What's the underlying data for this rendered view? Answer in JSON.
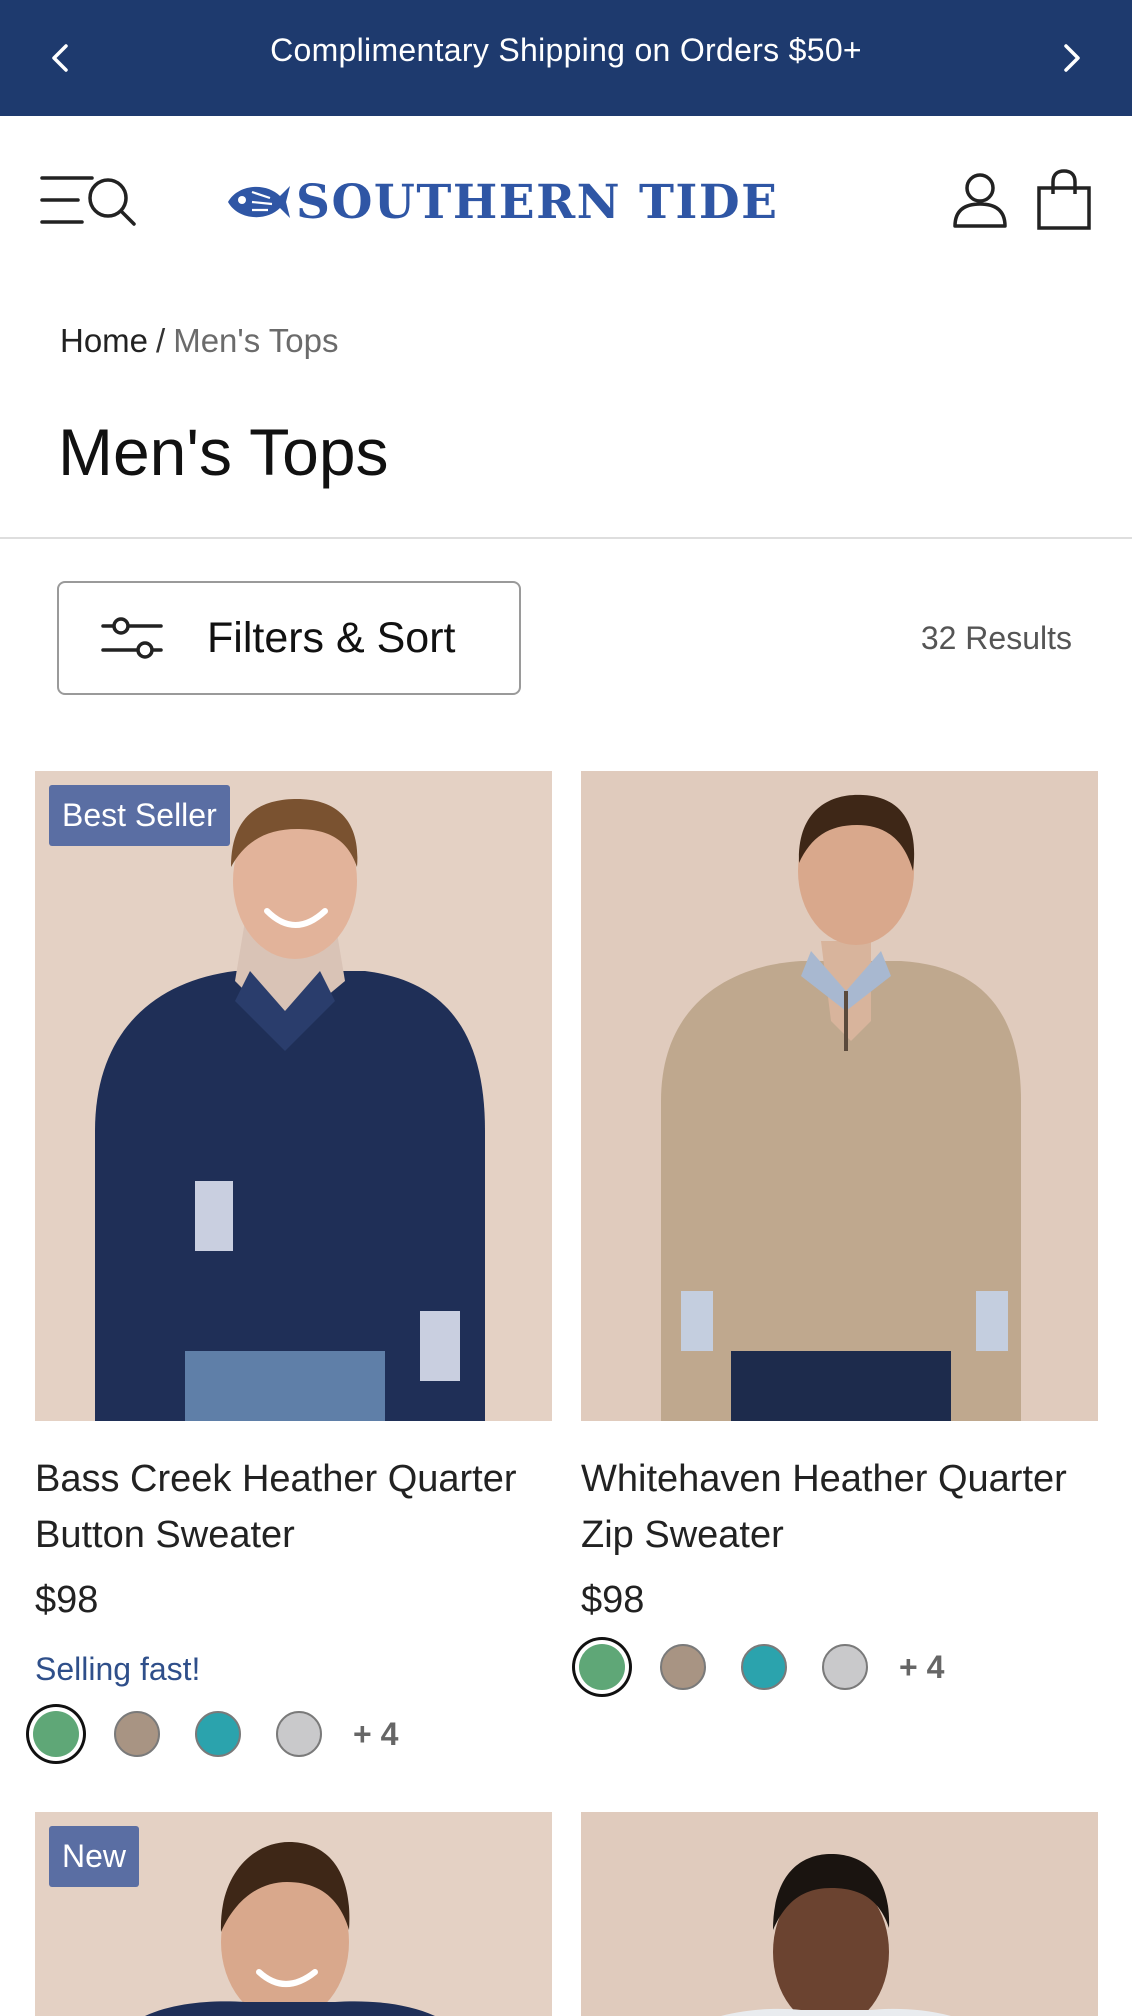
{
  "promo": {
    "text": "Complimentary Shipping on Orders $50+",
    "prev_icon": "chevron-left-icon",
    "next_icon": "chevron-right-icon",
    "background": "#1e3a6e"
  },
  "header": {
    "brand": "SOUTHERN TIDE",
    "brand_color": "#2f56a5",
    "menu_icon": "menu-search-icon",
    "account_icon": "account-icon",
    "bag_icon": "shopping-bag-icon"
  },
  "breadcrumb": {
    "home": "Home",
    "separator": "/",
    "current": "Men's Tops"
  },
  "page_title": "Men's Tops",
  "toolbar": {
    "filter_label": "Filters & Sort",
    "results": "32 Results"
  },
  "products": [
    {
      "badge": "Best Seller",
      "name": "Bass Creek Heather Quarter Button Sweater",
      "price": "$98",
      "note": "Selling fast!",
      "swatches": [
        "#5fa777",
        "#a89483",
        "#2ba3ad",
        "#c9c9cb"
      ],
      "more_colors": "+ 4",
      "garment_color": "#1f2f57"
    },
    {
      "badge": "",
      "name": "Whitehaven Heather Quarter Zip Sweater",
      "price": "$98",
      "note": "",
      "swatches": [
        "#5fa777",
        "#a89483",
        "#2ba3ad",
        "#c9c9cb"
      ],
      "more_colors": "+ 4",
      "garment_color": "#bfa88e"
    },
    {
      "badge": "New",
      "name": "",
      "price": "",
      "note": "",
      "swatches": [],
      "more_colors": "",
      "garment_color": "#1f2f57"
    },
    {
      "badge": "",
      "name": "",
      "price": "",
      "note": "",
      "swatches": [],
      "more_colors": "",
      "garment_color": "#e9ecef"
    }
  ]
}
